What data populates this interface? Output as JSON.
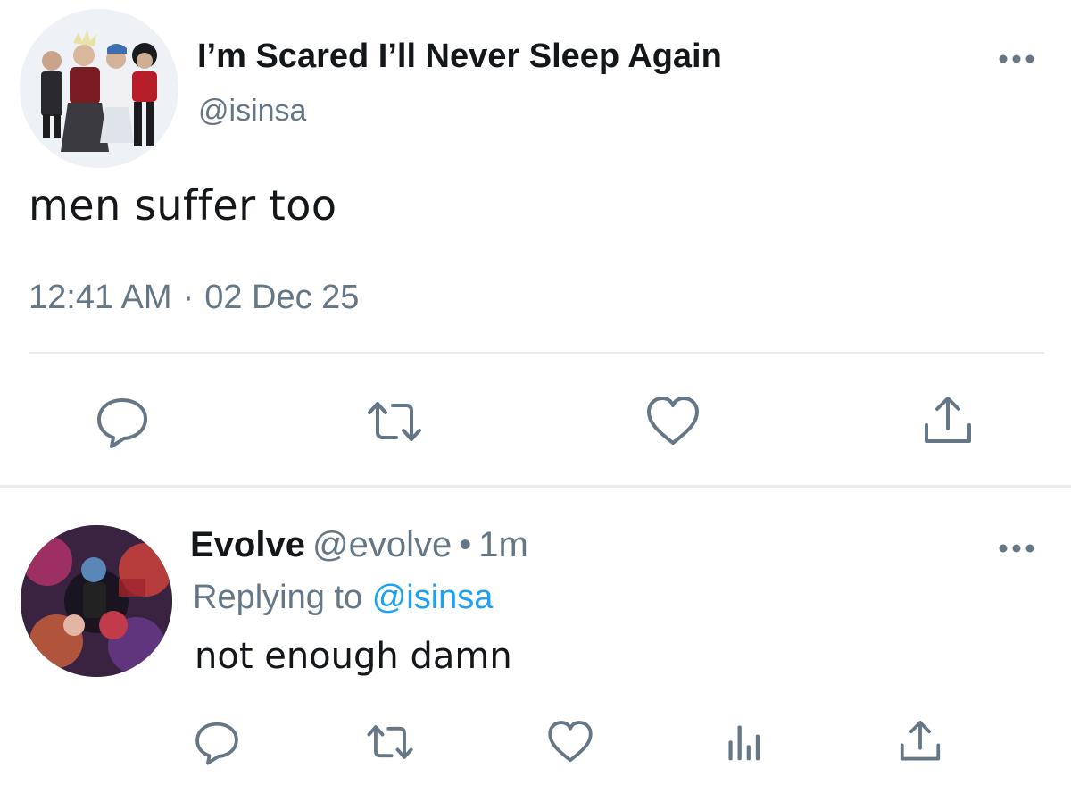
{
  "main_tweet": {
    "display_name": "I’m Scared I’ll Never Sleep Again",
    "handle": "@isinsa",
    "text": "men suffer too",
    "time": "12:41 AM",
    "date": "02 Dec 25",
    "time_separator": "·",
    "actions": [
      "reply-icon",
      "retweet-icon",
      "like-icon",
      "share-icon"
    ],
    "avatar_icon": "profile-photo"
  },
  "reply_tweet": {
    "display_name": "Evolve",
    "handle": "@evolve",
    "separator": "•",
    "age": "1m",
    "replying_prefix": "Replying to",
    "replying_to": "@isinsa",
    "text": "not enough damn",
    "actions": [
      "reply-icon",
      "retweet-icon",
      "like-icon",
      "analytics-icon",
      "share-icon"
    ],
    "avatar_icon": "profile-photo"
  },
  "colors": {
    "text": "#14171a",
    "secondary": "#657786",
    "link": "#1da1f2",
    "divider": "#e6ecf0",
    "icon": "#657786"
  }
}
